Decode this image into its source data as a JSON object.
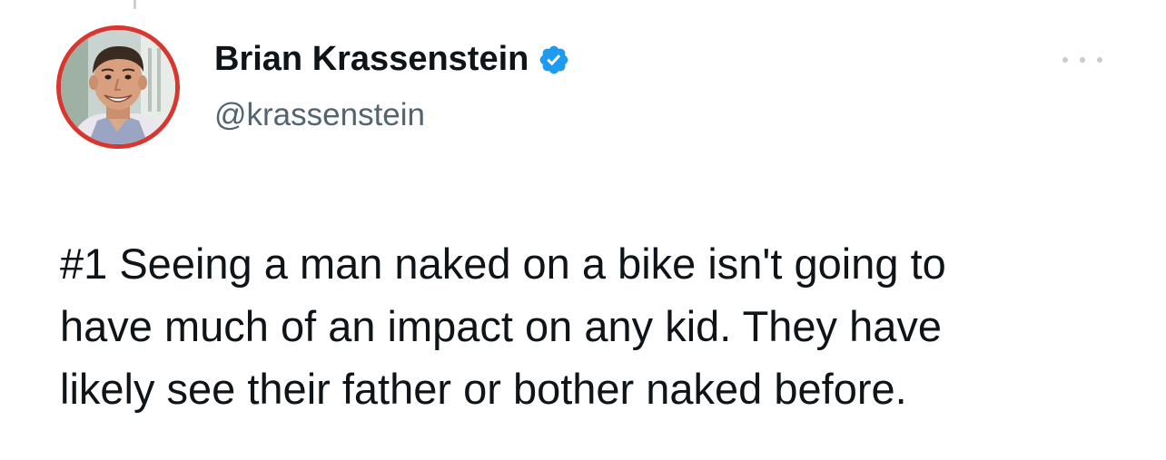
{
  "tweet": {
    "author": {
      "name": "Brian Krassenstein",
      "handle": "@krassenstein",
      "verified": true,
      "verified_badge_color": "#1d9bf0",
      "avatar_ring_color": "#d7372f"
    },
    "text": "#1 Seeing a man naked on a bike isn't going to\nhave much of an impact on any kid.  They have\nlikely see their father or bother naked before.",
    "more_icon": "more-horizontal-icon"
  }
}
